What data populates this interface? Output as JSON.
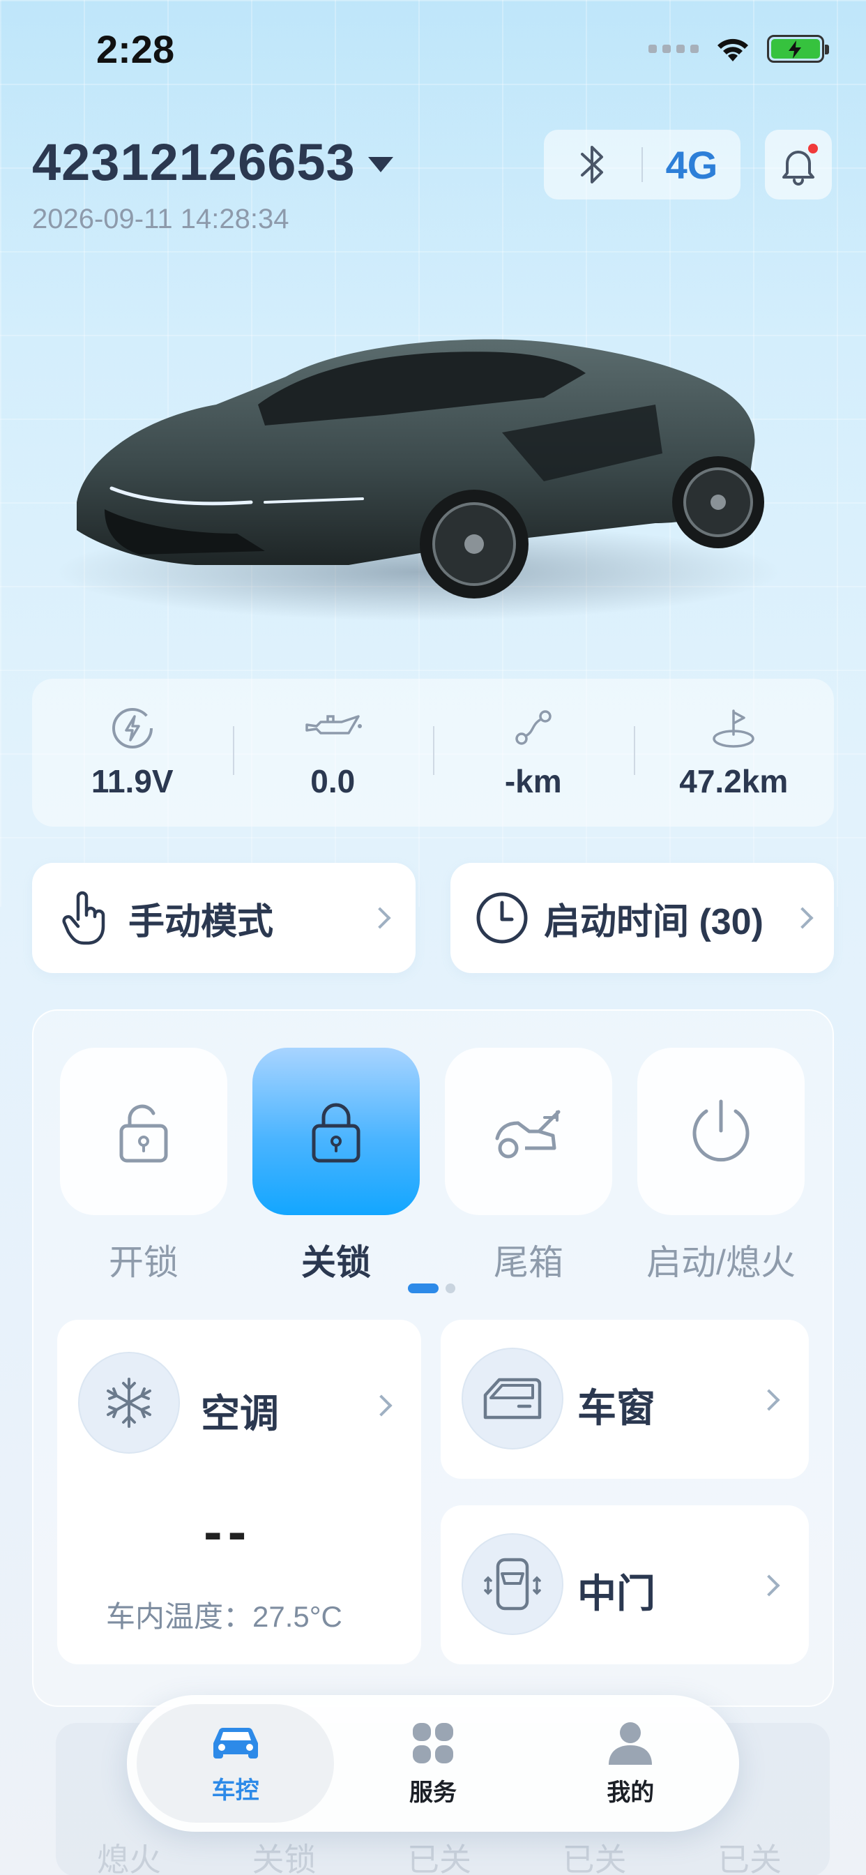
{
  "status_bar": {
    "time": "2:28"
  },
  "header": {
    "vehicle_id": "42312126653",
    "timestamp": "2026-09-11 14:28:34",
    "network_label": "4G"
  },
  "stats": [
    {
      "icon": "battery-voltage-icon",
      "value": "11.9V"
    },
    {
      "icon": "oil-can-icon",
      "value": "0.0"
    },
    {
      "icon": "route-icon",
      "value": "-km"
    },
    {
      "icon": "location-pin-icon",
      "value": "47.2km"
    }
  ],
  "modes": {
    "manual_label": "手动模式",
    "start_time_label": "启动时间 (30)"
  },
  "controls": [
    {
      "label": "开锁",
      "icon": "unlock-icon",
      "active": false
    },
    {
      "label": "关锁",
      "icon": "lock-icon",
      "active": true
    },
    {
      "label": "尾箱",
      "icon": "trunk-icon",
      "active": false
    },
    {
      "label": "启动/熄火",
      "icon": "power-icon",
      "active": false
    }
  ],
  "cards": {
    "ac": {
      "title": "空调",
      "value": "--",
      "inside_temp": "车内温度：27.5°C"
    },
    "window": {
      "title": "车窗"
    },
    "door": {
      "title": "中门"
    }
  },
  "faded_row": [
    "熄火",
    "关锁",
    "已关",
    "已关",
    "已关"
  ],
  "tabbar": [
    {
      "label": "车控",
      "icon": "car-icon",
      "active": true
    },
    {
      "label": "服务",
      "icon": "grid-icon",
      "active": false
    },
    {
      "label": "我的",
      "icon": "user-icon",
      "active": false
    }
  ],
  "colors": {
    "accent": "#2d8ae8",
    "active_tile": "#13a6ff",
    "text_dark": "#2b3850",
    "text_muted": "#8e9bab"
  }
}
